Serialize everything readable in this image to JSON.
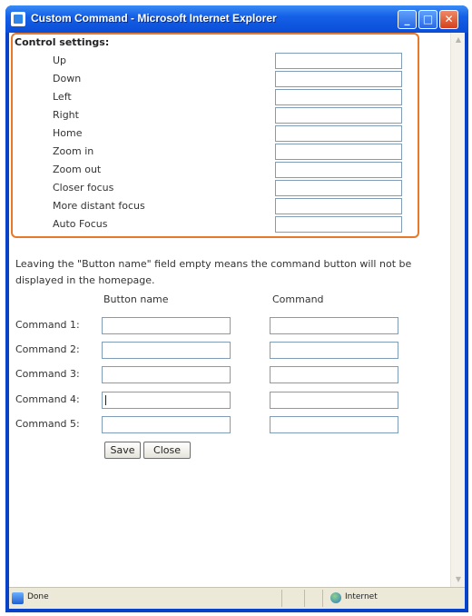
{
  "window": {
    "title": "Custom Command - Microsoft Internet Explorer",
    "minimize_glyph": "_",
    "maximize_glyph": "□",
    "close_glyph": "✕"
  },
  "control_settings": {
    "heading": "Control settings:",
    "rows": [
      {
        "label": "Up",
        "value": ""
      },
      {
        "label": "Down",
        "value": ""
      },
      {
        "label": "Left",
        "value": ""
      },
      {
        "label": "Right",
        "value": ""
      },
      {
        "label": "Home",
        "value": ""
      },
      {
        "label": "Zoom in",
        "value": ""
      },
      {
        "label": "Zoom out",
        "value": ""
      },
      {
        "label": "Closer focus",
        "value": ""
      },
      {
        "label": "More distant focus",
        "value": ""
      },
      {
        "label": "Auto Focus",
        "value": ""
      }
    ]
  },
  "note": "Leaving the \"Button name\" field empty means the command button will not be displayed in the homepage.",
  "columns": {
    "button_name": "Button name",
    "command": "Command"
  },
  "commands": [
    {
      "label": "Command 1:",
      "button_name": "",
      "command": ""
    },
    {
      "label": "Command 2:",
      "button_name": "",
      "command": ""
    },
    {
      "label": "Command 3:",
      "button_name": "",
      "command": ""
    },
    {
      "label": "Command 4:",
      "button_name": "",
      "command": ""
    },
    {
      "label": "Command 5:",
      "button_name": "",
      "command": ""
    }
  ],
  "buttons": {
    "save": "Save",
    "close": "Close"
  },
  "statusbar": {
    "status": "Done",
    "zone": "Internet"
  },
  "icons": {
    "app": "ie-page-icon",
    "status": "ie-page-icon",
    "zone": "globe-icon"
  },
  "colors": {
    "titlebar": "#0a4ed8",
    "highlight": "#e8792b",
    "input_border": "#7f9db9",
    "statusbar": "#ece9d8"
  }
}
